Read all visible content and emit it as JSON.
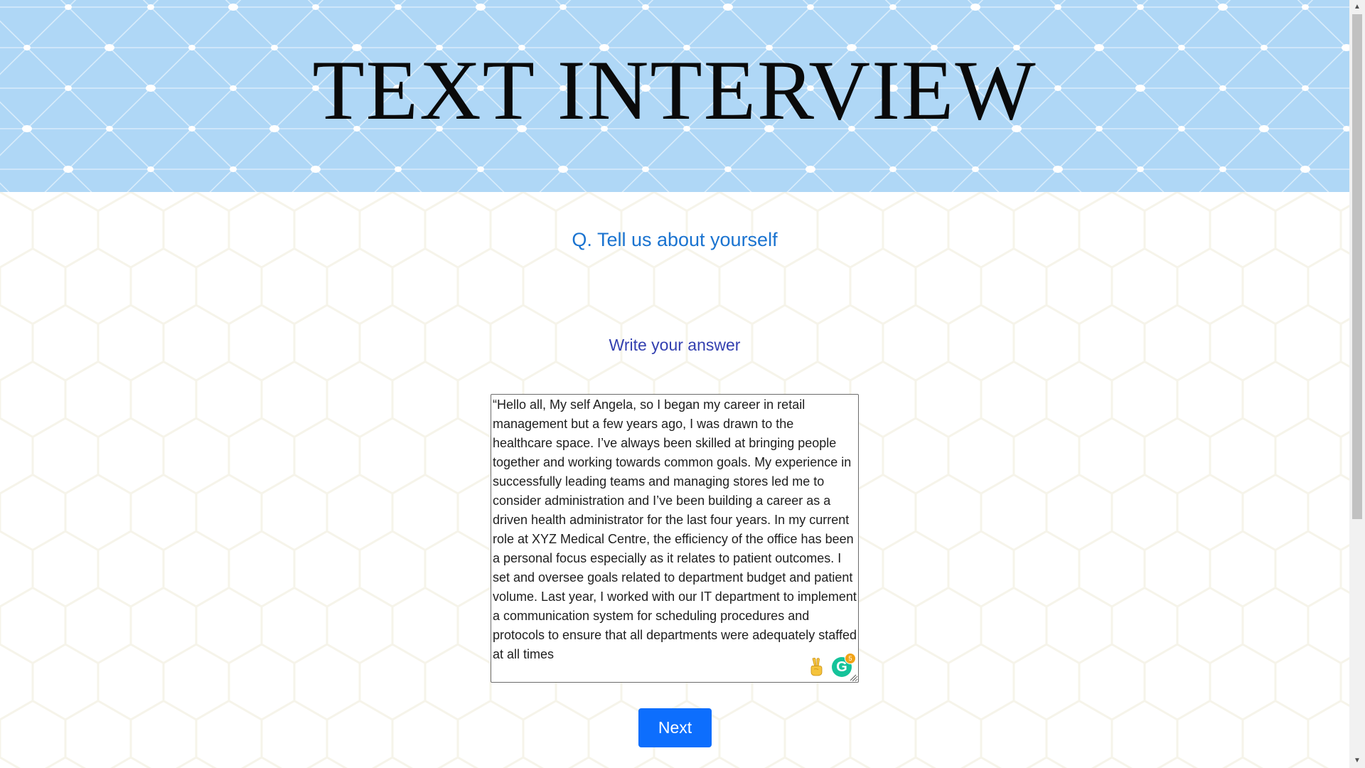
{
  "header": {
    "title": "TEXT INTERVIEW"
  },
  "question": {
    "text": "Q. Tell us about yourself"
  },
  "answer": {
    "label": "Write your answer",
    "value": "“Hello all, My self Angela, so I began my career in retail management but a few years ago, I was drawn to the healthcare space. I’ve always been skilled at bringing people together and working towards common goals. My experience in successfully leading teams and managing stores led me to consider administration and I’ve been building a career as a driven health administrator for the last four years. In my current role at XYZ Medical Centre, the efficiency of the office has been a personal focus especially as it relates to patient outcomes. I set and oversee goals related to department budget and patient volume. Last year, I worked with our IT department to implement a communication system for scheduling procedures and protocols to ensure that all departments were adequately staffed at all times",
    "grammarly_count": "5",
    "icons": [
      "victory-hand-emoji-icon",
      "grammarly-icon"
    ]
  },
  "actions": {
    "next_label": "Next"
  },
  "colors": {
    "banner_background": "#afd7f6",
    "question_text": "#1a73d0",
    "label_text": "#3340b0",
    "next_button": "#0d6efd"
  }
}
